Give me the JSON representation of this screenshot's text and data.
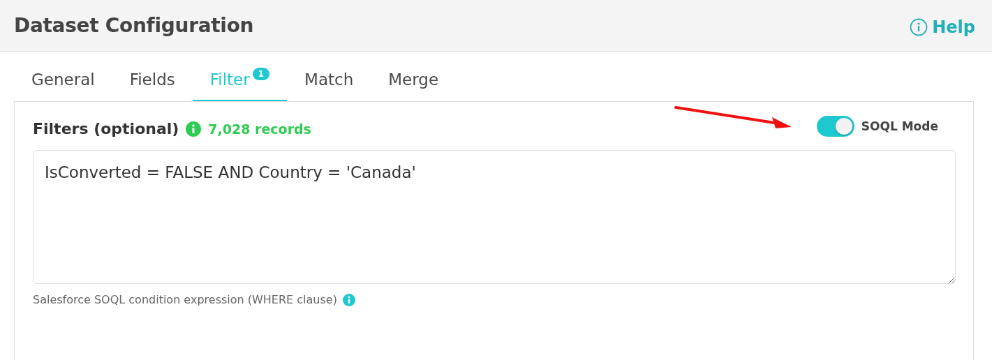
{
  "header": {
    "title": "Dataset Configuration",
    "help_link": "Help"
  },
  "tabs": [
    {
      "label": "General",
      "selected": false
    },
    {
      "label": "Fields",
      "selected": false
    },
    {
      "label": "Filter",
      "selected": true,
      "badge": "1"
    },
    {
      "label": "Match",
      "selected": false
    },
    {
      "label": "Merge",
      "selected": false
    }
  ],
  "filters": {
    "title": "Filters (optional)",
    "record_count": "7,028 records",
    "soql_mode": {
      "label": "SOQL Mode",
      "on": true
    },
    "expression": "IsConverted = FALSE AND Country = 'Canada'",
    "hint": "Salesforce SOQL condition expression (WHERE clause)"
  }
}
